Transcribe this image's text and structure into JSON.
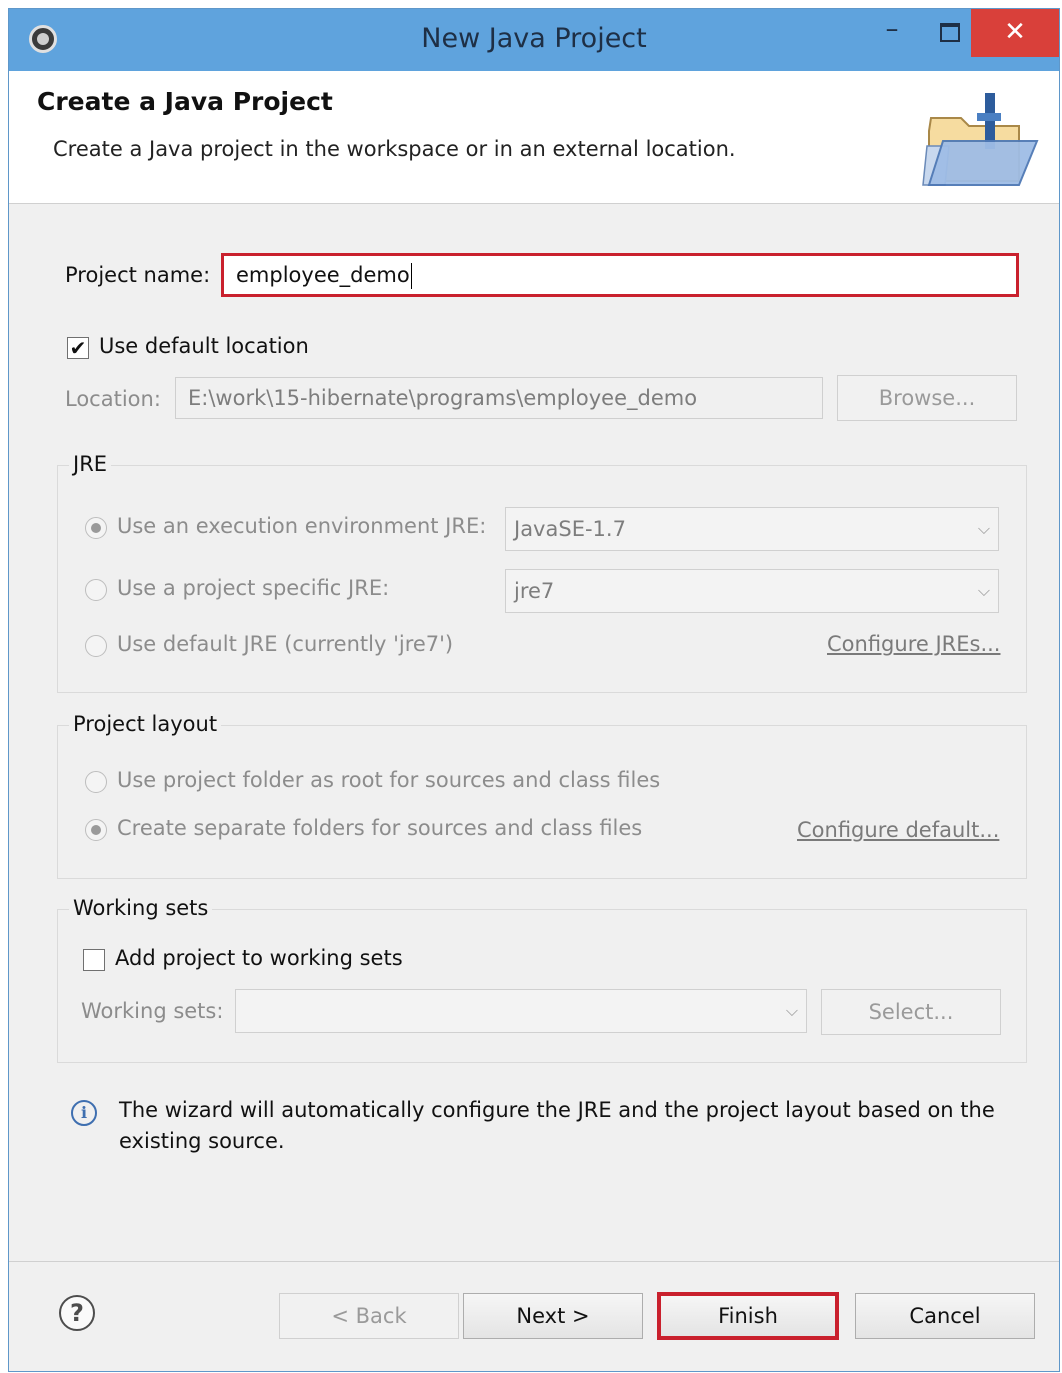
{
  "window": {
    "title": "New Java Project",
    "minimize_glyph": "–",
    "close_glyph": "✕",
    "app_icon": "eclipse-icon"
  },
  "header": {
    "title": "Create a Java Project",
    "description": "Create a Java project in the workspace or in an external location.",
    "icon": "java-folder-icon"
  },
  "project": {
    "name_label": "Project name:",
    "name_value": "employee_demo"
  },
  "location": {
    "use_default_label": "Use default location",
    "use_default_checked": true,
    "check_glyph": "✔",
    "location_label": "Location:",
    "location_value": "E:\\work\\15-hibernate\\programs\\employee_demo",
    "browse_label": "Browse..."
  },
  "jre": {
    "group_title": "JRE",
    "options": [
      {
        "label": "Use an execution environment JRE:",
        "selected": true,
        "value": "JavaSE-1.7"
      },
      {
        "label": "Use a project specific JRE:",
        "selected": false,
        "value": "jre7"
      },
      {
        "label": "Use default JRE (currently 'jre7')",
        "selected": false
      }
    ],
    "configure_link": "Configure JREs...",
    "chevron_glyph": "⌵"
  },
  "layout": {
    "group_title": "Project layout",
    "options": [
      {
        "label": "Use project folder as root for sources and class files",
        "selected": false
      },
      {
        "label": "Create separate folders for sources and class files",
        "selected": true
      }
    ],
    "configure_link": "Configure default..."
  },
  "working_sets": {
    "group_title": "Working sets",
    "add_label": "Add project to working sets",
    "add_checked": false,
    "sets_label": "Working sets:",
    "sets_value": "",
    "select_label": "Select..."
  },
  "info": {
    "glyph": "i",
    "text": "The wizard will automatically configure the JRE and the project layout based on the existing source."
  },
  "footer": {
    "help_glyph": "?",
    "back_label": "< Back",
    "next_label": "Next >",
    "finish_label": "Finish",
    "cancel_label": "Cancel"
  },
  "colors": {
    "titlebar": "#5fa3dd",
    "close_button": "#d9403a",
    "highlight_border": "#c9202d"
  }
}
